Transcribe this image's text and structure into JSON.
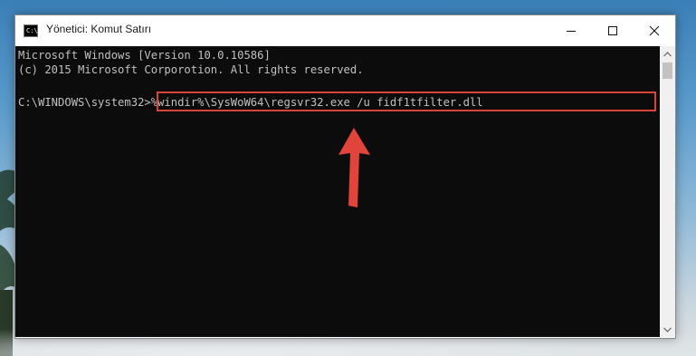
{
  "window": {
    "title": "Yönetici: Komut Satırı",
    "icon": "cmd-icon",
    "icon_prompt": "C:\\",
    "controls": [
      "minimize-icon",
      "maximize-icon",
      "close-icon"
    ]
  },
  "console": {
    "lines": [
      "Microsoft Windows [Version 10.0.10586]",
      "(c) 2015 Microsoft Corporotion. All rights reserved."
    ],
    "prompt": "C:\\WINDOWS\\system32>",
    "command": "%windir%\\SysWoW64\\regsvr32.exe /u fidf1tfilter.dll",
    "text_color": "#c0c0c0",
    "background": "#0c0c0c"
  },
  "annotation": {
    "highlight_color": "#d9433a",
    "arrow_icon": "red-arrow-icon"
  },
  "scrollbar": {
    "up_icon": "scroll-up-icon",
    "down_icon": "scroll-down-icon"
  }
}
